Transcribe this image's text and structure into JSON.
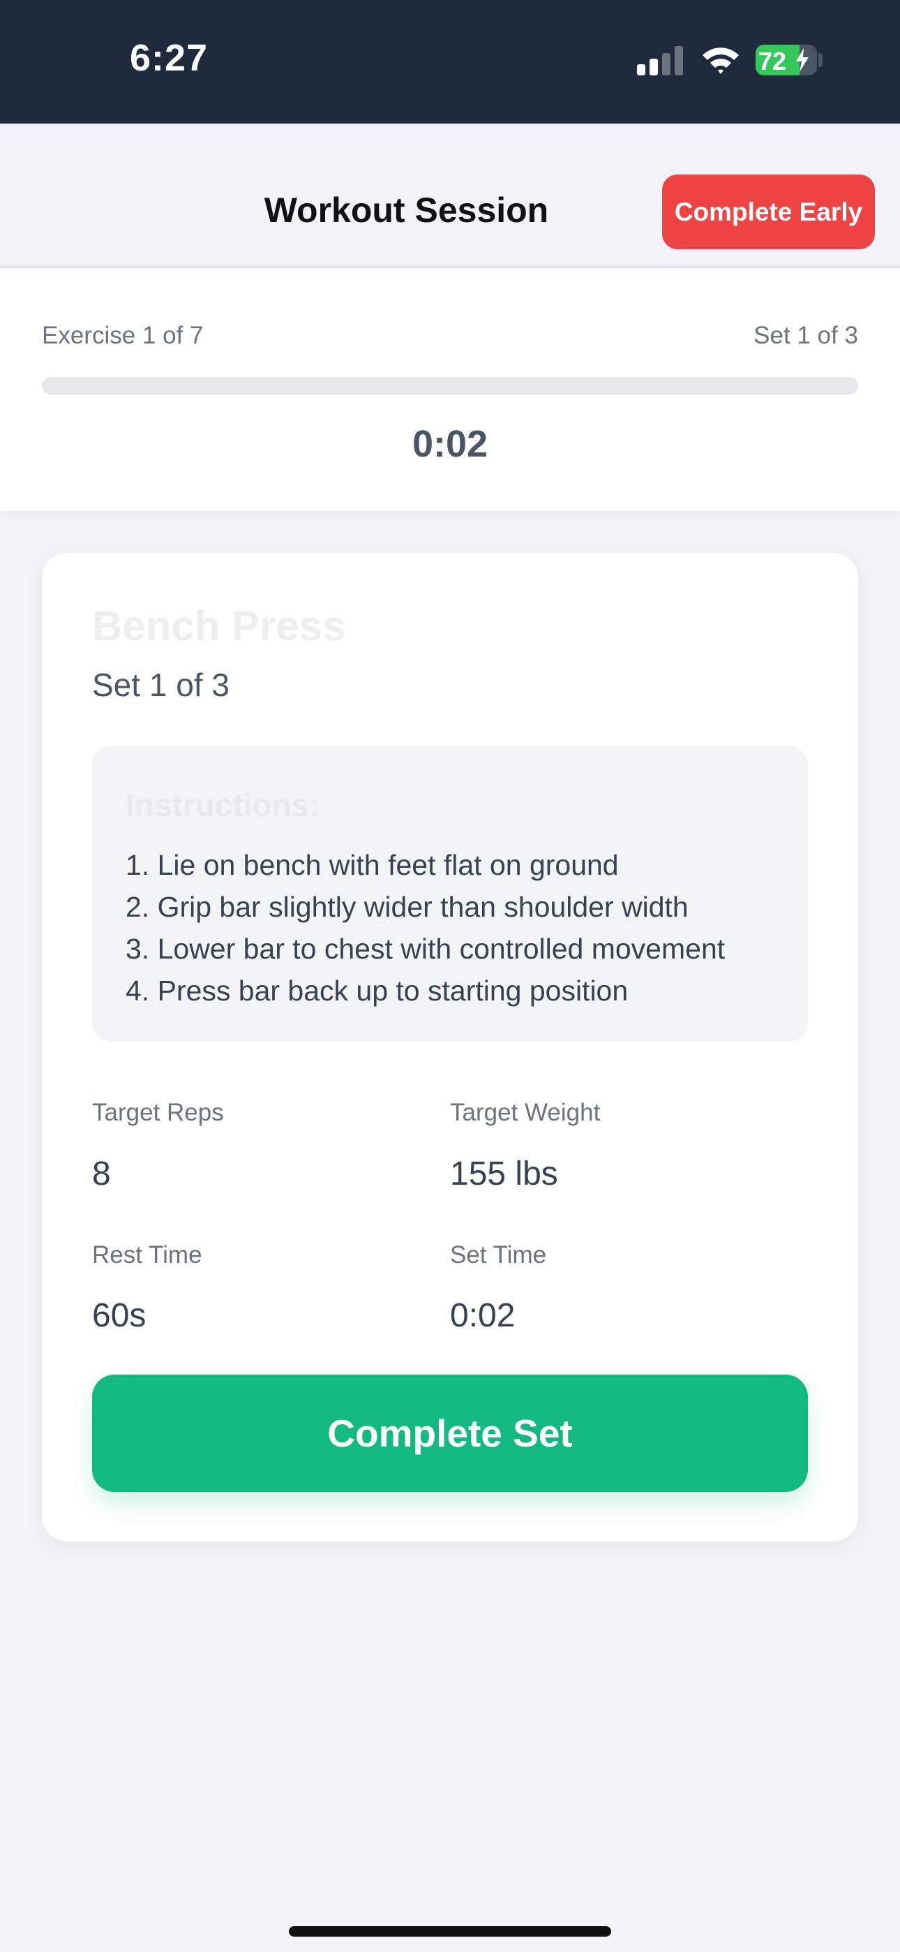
{
  "status_bar": {
    "time": "6:27",
    "battery_level": "72",
    "battery_charging": true,
    "signal_bars_active": 2,
    "signal_bars_total": 4,
    "icons": [
      "signal-icon",
      "wifi-icon",
      "battery-icon",
      "charging-bolt-icon"
    ]
  },
  "nav": {
    "title": "Workout Session",
    "complete_early_label": "Complete Early"
  },
  "progress": {
    "exercise_label": "Exercise 1 of 7",
    "set_label": "Set 1 of 3",
    "fraction": 0,
    "elapsed": "0:02"
  },
  "exercise": {
    "name": "Bench Press",
    "set_label": "Set 1 of 3",
    "instructions_heading": "Instructions:",
    "instructions": [
      "1. Lie on bench with feet flat on ground",
      "2. Grip bar slightly wider than shoulder width",
      "3. Lower bar to chest with controlled movement",
      "4. Press bar back up to starting position"
    ],
    "stats": {
      "target_reps_label": "Target Reps",
      "target_reps": "8",
      "target_weight_label": "Target Weight",
      "target_weight": "155 lbs",
      "rest_time_label": "Rest Time",
      "rest_time": "60s",
      "set_time_label": "Set Time",
      "set_time": "0:02"
    },
    "complete_set_label": "Complete Set"
  },
  "colors": {
    "status_bar_bg": "#202a3d",
    "page_bg": "#f2f2f8",
    "danger": "#ef4444",
    "success": "#12b981",
    "battery": "#34c759"
  }
}
